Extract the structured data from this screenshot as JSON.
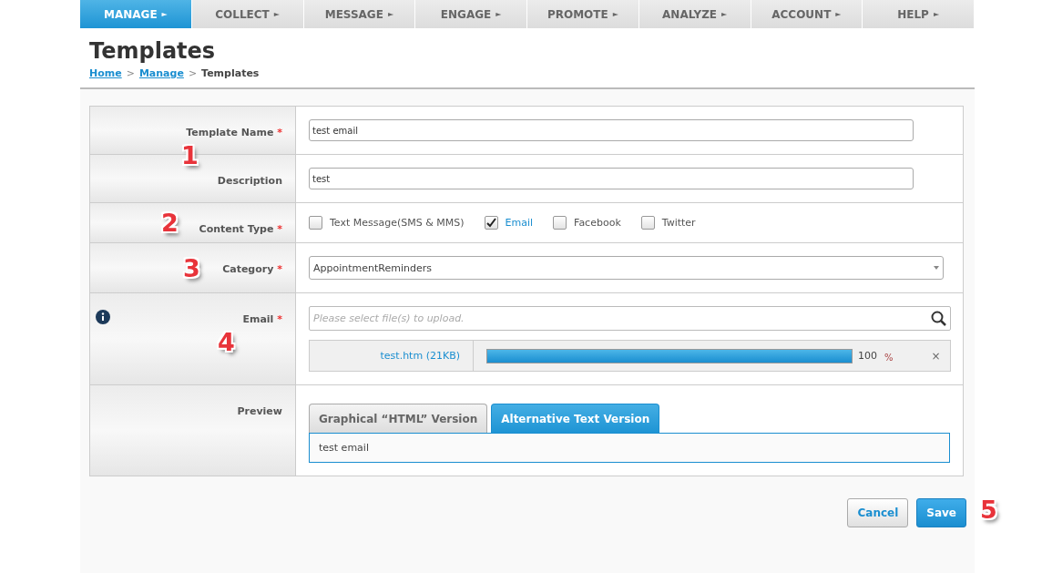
{
  "nav": [
    {
      "label": "MANAGE",
      "arrow": "►",
      "selected": true
    },
    {
      "label": "COLLECT",
      "arrow": "►",
      "selected": false
    },
    {
      "label": "MESSAGE",
      "arrow": "►",
      "selected": false
    },
    {
      "label": "ENGAGE",
      "arrow": "►",
      "selected": false
    },
    {
      "label": "PROMOTE",
      "arrow": "►",
      "selected": false
    },
    {
      "label": "ANALYZE",
      "arrow": "►",
      "selected": false
    },
    {
      "label": "ACCOUNT",
      "arrow": "►",
      "selected": false
    },
    {
      "label": "HELP",
      "arrow": "►",
      "selected": false
    }
  ],
  "page_title": "Templates",
  "breadcrumb": {
    "links": [
      "Home",
      "Manage"
    ],
    "separator": ">",
    "current": "Templates"
  },
  "form_rows": [
    {
      "kind": "text",
      "label": "Template Name",
      "required": "*",
      "value": "test email",
      "marker": "1"
    },
    {
      "kind": "text",
      "label": "Description",
      "value": "test"
    },
    {
      "kind": "checkboxes",
      "label": "Content Type",
      "required": "*",
      "marker": "2",
      "options": [
        {
          "label": "Text Message(SMS & MMS)",
          "checked": false
        },
        {
          "label": "Email",
          "checked": true
        },
        {
          "label": "Facebook",
          "checked": false
        },
        {
          "label": "Twitter",
          "checked": false
        }
      ]
    },
    {
      "kind": "select",
      "label": "Category",
      "required": "*",
      "value": "AppointmentReminders",
      "marker": "3"
    },
    {
      "kind": "upload",
      "label": "Email",
      "required": "*",
      "marker": "4",
      "info": true,
      "placeholder": "Please select file(s) to upload.",
      "file": {
        "name": "test.htm (21KB)",
        "level": 1,
        "reading": "100",
        "unit": "%",
        "remove": "×"
      }
    },
    {
      "kind": "preview",
      "label": "Preview",
      "tabs": [
        {
          "label": "Graphical “HTML” Version",
          "selected": false
        },
        {
          "label": "Alternative Text Version",
          "selected": true
        }
      ],
      "content": "test email"
    }
  ],
  "buttons": [
    {
      "kind": "secondary",
      "label": "Cancel"
    },
    {
      "kind": "primary",
      "label": "Save"
    }
  ],
  "buttons_marker": "5"
}
